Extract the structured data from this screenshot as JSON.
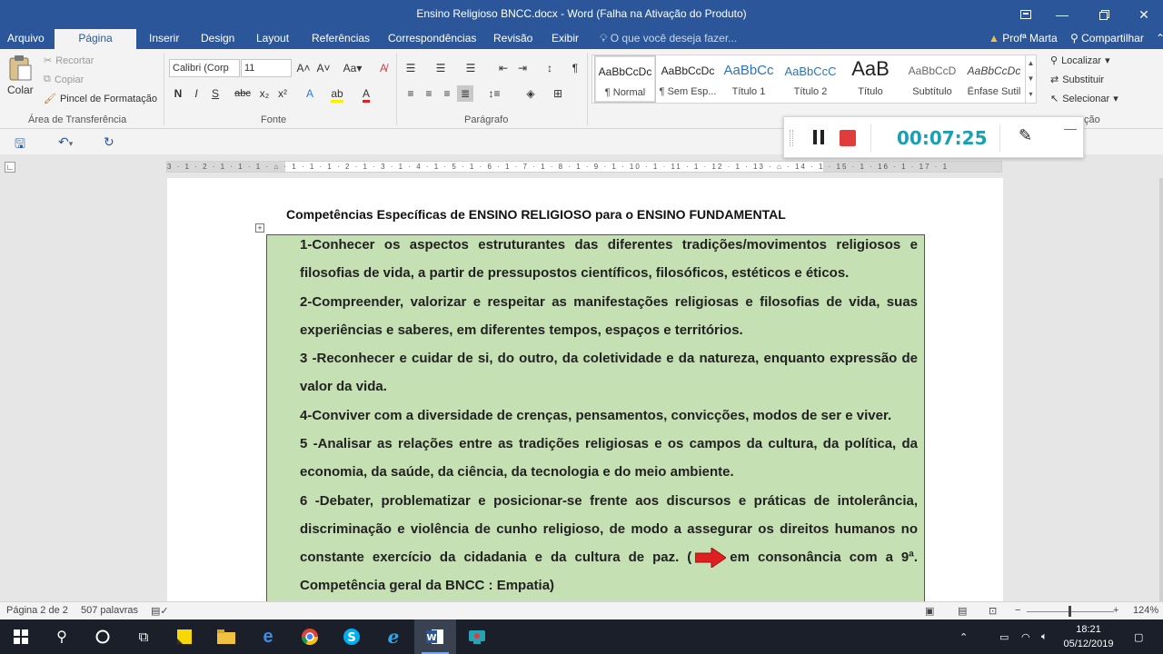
{
  "window": {
    "title": "Ensino Religioso BNCC.docx - Word (Falha na Ativação do Produto)"
  },
  "tabs": [
    "Arquivo",
    "Página Inicial",
    "Inserir",
    "Design",
    "Layout",
    "Referências",
    "Correspondências",
    "Revisão",
    "Exibir"
  ],
  "active_tab": "Página Inicial",
  "tell_me": "O que você deseja fazer...",
  "user_name": "Profª Marta",
  "share_label": "Compartilhar",
  "ribbon": {
    "clipboard": {
      "paste": "Colar",
      "cut": "Recortar",
      "copy": "Copiar",
      "format_painter": "Pincel de Formatação",
      "group": "Área de Transferência"
    },
    "font": {
      "name": "Calibri (Corp",
      "size": "11",
      "group": "Fonte"
    },
    "paragraph": {
      "group": "Parágrafo"
    },
    "styles": {
      "items": [
        {
          "preview": "AaBbCcDc",
          "name": "¶ Normal"
        },
        {
          "preview": "AaBbCcDc",
          "name": "¶ Sem Esp..."
        },
        {
          "preview": "AaBbCc",
          "name": "Título 1"
        },
        {
          "preview": "AaBbCcC",
          "name": "Título 2"
        },
        {
          "preview": "AaB",
          "name": "Título"
        },
        {
          "preview": "AaBbCcD",
          "name": "Subtítulo"
        },
        {
          "preview": "AaBbCcDc",
          "name": "Ênfase Sutil"
        }
      ]
    },
    "editing": {
      "find": "Localizar",
      "replace": "Substituir",
      "select": "Selecionar",
      "group_partial": "ção"
    }
  },
  "recorder": {
    "time": "00:07:25"
  },
  "ruler_text": "3 · 1 · 2 · 1 · 1 · 1 · ⌂ · 1 · 1 · 1 · 2 · 1 · 3 · 1 · 4 · 1 · 5 · 1 · 6 · 1 · 7 · 1 · 8 · 1 · 9 · 1 · 10 · 1 · 11 · 1 · 12 · 1 · 13 · ⌂ · 14 · 1 · 15 · 1 · 16 · 1 · 17 · 1",
  "document": {
    "heading": "Competências Específicas de ENSINO RELIGIOSO para o ENSINO FUNDAMENTAL",
    "lines": [
      "1-Conhecer os aspectos estruturantes das diferentes tradições/movimentos religiosos e",
      "filosofias de vida, a partir de pressupostos científicos, filosóficos, estéticos e éticos.",
      "2-Compreender, valorizar e respeitar as manifestações religiosas e filosofias de vida, suas",
      "experiências e saberes, em diferentes tempos, espaços e territórios.",
      "3 -Reconhecer e cuidar de si, do outro, da coletividade e da natureza, enquanto expressão de",
      "valor da vida.",
      "4-Conviver com a diversidade de crenças, pensamentos, convicções, modos de ser e viver.",
      "5 -Analisar as relações entre as tradições religiosas e os campos da cultura, da política, da",
      "economia, da saúde, da ciência, da tecnologia e do meio ambiente.",
      "6 -Debater, problematizar e posicionar-se frente aos discursos e práticas de intolerância,",
      "discriminação e violência de cunho religioso, de modo a assegurar os direitos humanos no"
    ],
    "line_arrow_before": "constante exercício da cidadania e da cultura de paz.   (",
    "line_arrow_after": "em consonância com a 9ª.",
    "line_last": "Competência geral da BNCC : Empatia)",
    "colors": {
      "box_fill": "#c5e0b3",
      "arrow": "#e02020"
    }
  },
  "status": {
    "page": "Página 2 de 2",
    "words": "507 palavras",
    "zoom": "124%"
  },
  "taskbar": {
    "time": "18:21",
    "date": "05/12/2019",
    "icons": [
      "windows-icon",
      "search-icon",
      "cortana-icon",
      "task-view-icon",
      "sticky-notes-icon",
      "file-explorer-icon",
      "edge-icon",
      "chrome-icon",
      "skype-icon",
      "ie-icon",
      "word-icon",
      "screen-recorder-icon"
    ]
  }
}
